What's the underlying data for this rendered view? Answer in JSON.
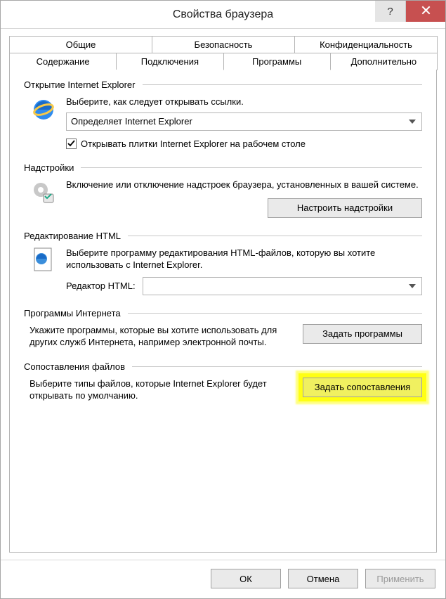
{
  "window": {
    "title": "Свойства браузера"
  },
  "tabs": {
    "row1": [
      "Общие",
      "Безопасность",
      "Конфиденциальность"
    ],
    "row2": [
      "Содержание",
      "Подключения",
      "Программы",
      "Дополнительно"
    ],
    "active": "Программы"
  },
  "sections": {
    "opening": {
      "title": "Открытие Internet Explorer",
      "desc": "Выберите, как следует открывать ссылки.",
      "select_value": "Определяет Internet Explorer",
      "checkbox_label": "Открывать плитки Internet Explorer на рабочем столе",
      "checkbox_checked": true
    },
    "addons": {
      "title": "Надстройки",
      "desc": "Включение или отключение надстроек браузера, установленных в вашей системе.",
      "button": "Настроить надстройки"
    },
    "html_edit": {
      "title": "Редактирование HTML",
      "desc": "Выберите программу редактирования HTML-файлов, которую вы хотите использовать с Internet Explorer.",
      "editor_label": "Редактор HTML:",
      "editor_value": ""
    },
    "internet_programs": {
      "title": "Программы Интернета",
      "desc": "Укажите программы, которые вы хотите использовать для других служб Интернета, например электронной почты.",
      "button": "Задать программы"
    },
    "file_assoc": {
      "title": "Сопоставления файлов",
      "desc": "Выберите типы файлов, которые Internet Explorer будет открывать по умолчанию.",
      "button": "Задать сопоставления"
    }
  },
  "footer": {
    "ok": "ОК",
    "cancel": "Отмена",
    "apply": "Применить"
  }
}
